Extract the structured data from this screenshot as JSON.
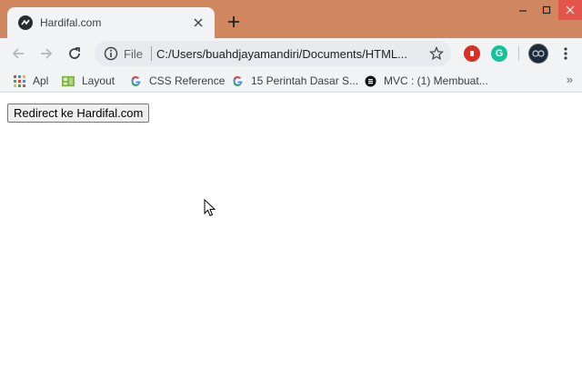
{
  "tab": {
    "title": "Hardifal.com"
  },
  "omnibox": {
    "scheme_label": "File",
    "url": "C:/Users/buahdjayamandiri/Documents/HTML..."
  },
  "extensions": {
    "grammarly_letter": "G"
  },
  "bookmarks": [
    {
      "label": "Apl",
      "icon": "apps-grid-icon"
    },
    {
      "label": "Layout",
      "icon": "layout-thumbnail-icon"
    },
    {
      "label": "CSS Reference",
      "icon": "google-g-icon"
    },
    {
      "label": "15 Perintah Dasar S...",
      "icon": "google-g-icon"
    },
    {
      "label": "MVC : (1) Membuat...",
      "icon": "dark-circle-icon"
    }
  ],
  "bookmarks_overflow": "»",
  "page": {
    "redirect_button_label": "Redirect ke Hardifal.com"
  },
  "colors": {
    "titlebar": "#d0865e",
    "tab_background": "#f2f3f4",
    "omnibox_background": "#e8eaed",
    "ext_red": "#d93025",
    "ext_green": "#15c39a"
  }
}
